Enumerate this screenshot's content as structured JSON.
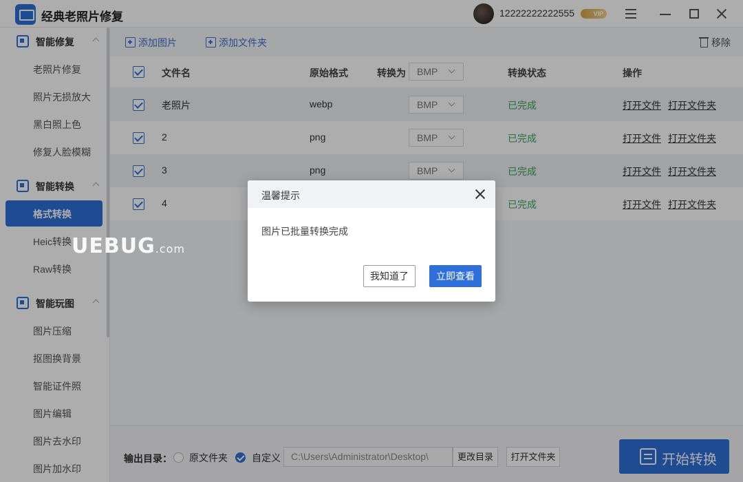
{
  "app": {
    "title": "经典老照片修复",
    "user_phone": "12222222222555",
    "vip_label": "VIP"
  },
  "sidebar": {
    "groups": [
      {
        "label": "智能修复",
        "items": [
          "老照片修复",
          "照片无损放大",
          "黑白照上色",
          "修复人脸模糊"
        ]
      },
      {
        "label": "智能转换",
        "items": [
          "格式转换",
          "Heic转换",
          "Raw转换"
        ]
      },
      {
        "label": "智能玩图",
        "items": [
          "图片压缩",
          "抠图换背景",
          "智能证件照",
          "图片编辑",
          "图片去水印",
          "图片加水印"
        ]
      }
    ],
    "active_item": "格式转换"
  },
  "toolbar": {
    "add_image": "添加图片",
    "add_folder": "添加文件夹",
    "remove": "移除"
  },
  "table": {
    "headers": {
      "filename": "文件名",
      "orig_format": "原始格式",
      "convert_to": "转换为",
      "status": "转换状态",
      "action": "操作"
    },
    "header_format": "BMP",
    "rows": [
      {
        "name": "老照片",
        "format": "webp",
        "target": "BMP",
        "status": "已完成",
        "open_file": "打开文件",
        "open_folder": "打开文件夹"
      },
      {
        "name": "2",
        "format": "png",
        "target": "BMP",
        "status": "已完成",
        "open_file": "打开文件",
        "open_folder": "打开文件夹"
      },
      {
        "name": "3",
        "format": "png",
        "target": "BMP",
        "status": "已完成",
        "open_file": "打开文件",
        "open_folder": "打开文件夹"
      },
      {
        "name": "4",
        "format": "",
        "target": "",
        "status": "已完成",
        "open_file": "打开文件",
        "open_folder": "打开文件夹"
      }
    ]
  },
  "bottom": {
    "output_label": "输出目录：",
    "option_original": "原文件夹",
    "option_custom": "自定义",
    "path": "C:\\Users\\Administrator\\Desktop\\",
    "change_dir": "更改目录",
    "open_folder": "打开文件夹",
    "start": "开始转换"
  },
  "watermark": {
    "text": "UEBUG",
    "suffix": ".com"
  },
  "dialog": {
    "title": "温馨提示",
    "message": "图片已批量转换完成",
    "ok_label": "我知道了",
    "view_label": "立即查看"
  },
  "colors": {
    "accent": "#2f6fd9",
    "success": "#3aa55b"
  }
}
